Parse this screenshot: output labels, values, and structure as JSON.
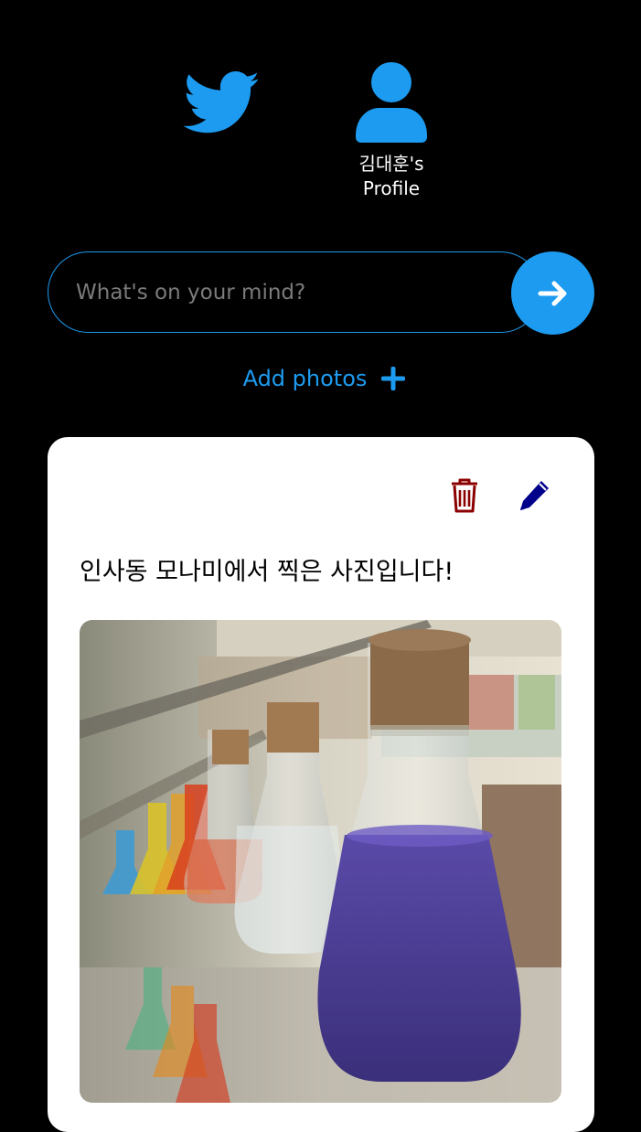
{
  "nav": {
    "home_icon": "twitter-bird-icon",
    "profile_icon": "user-icon",
    "profile_label": "김대훈's Profile"
  },
  "composer": {
    "placeholder": "What's on your mind?",
    "value": "",
    "submit_icon": "arrow-right-icon"
  },
  "add_photos": {
    "label": "Add photos",
    "icon": "plus-icon"
  },
  "tweet": {
    "text": "인사동 모나미에서 찍은 사진입니다!",
    "delete_icon": "trash-icon",
    "edit_icon": "pencil-icon",
    "photo_description_icon": "photo"
  },
  "colors": {
    "background": "#000000",
    "accent": "#1d9bf0",
    "card": "#ffffff",
    "delete": "#8b0000",
    "edit": "#00008b"
  }
}
